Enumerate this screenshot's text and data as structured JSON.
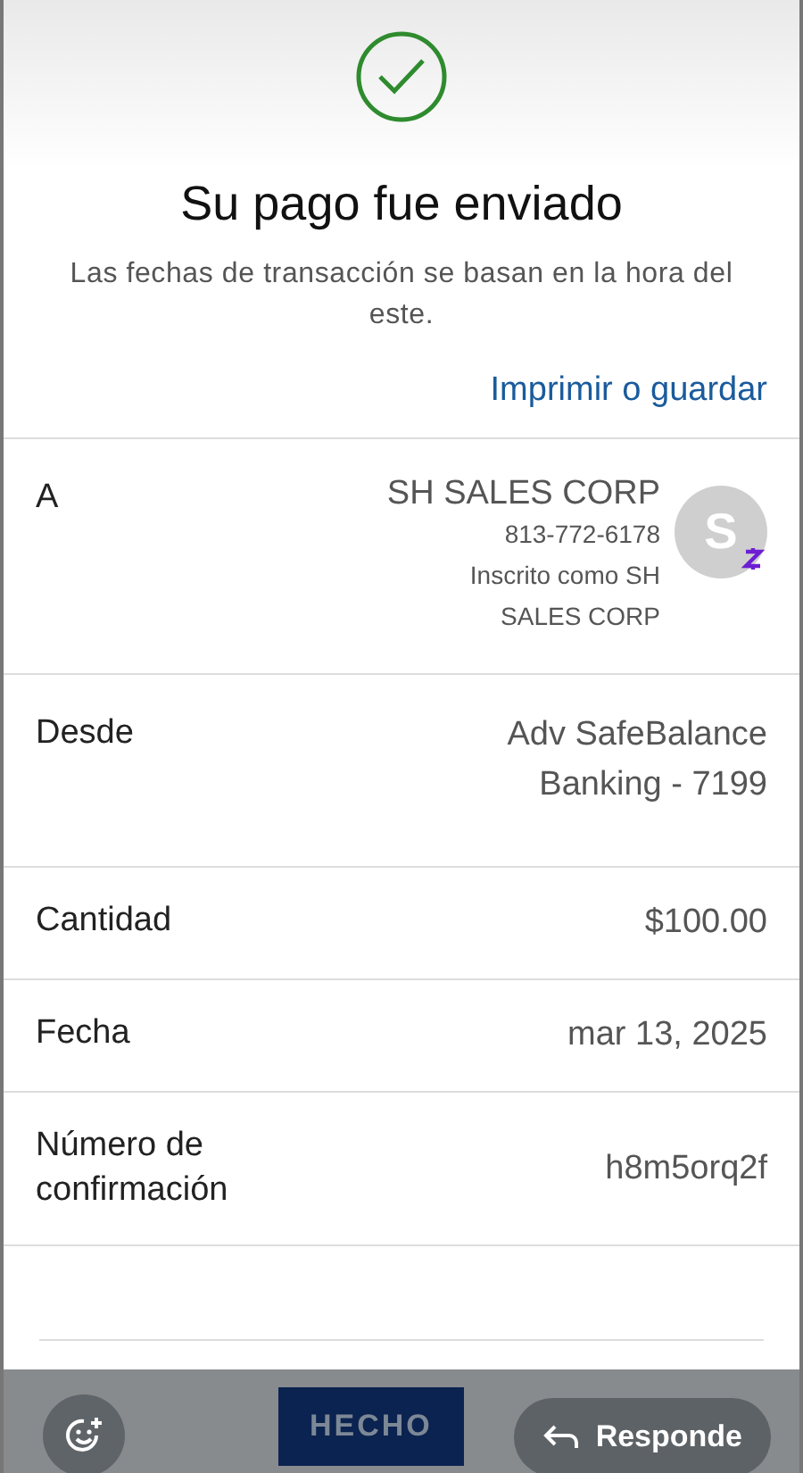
{
  "header": {
    "title": "Su pago fue enviado",
    "subtitle": "Las fechas de transacción se basan en la hora del este.",
    "print_link": "Imprimir o guardar"
  },
  "details": [
    {
      "kind": "recipient",
      "label": "A",
      "name": "SH SALES CORP",
      "phone": "813-772-6178",
      "enrolled_as": "Inscrito como SH SALES CORP",
      "avatar": "S"
    },
    {
      "kind": "simple",
      "label": "Desde",
      "value": "Adv SafeBalance Banking - 7199"
    },
    {
      "kind": "simple",
      "label": "Cantidad",
      "value": "$100.00"
    },
    {
      "kind": "simple",
      "label": "Fecha",
      "value": "mar 13, 2025"
    },
    {
      "kind": "simple",
      "label": "Número de confirmación",
      "value": "h8m5orq2f"
    }
  ],
  "footer": {
    "done_button": "HECHO",
    "reply_button": "Responde"
  }
}
